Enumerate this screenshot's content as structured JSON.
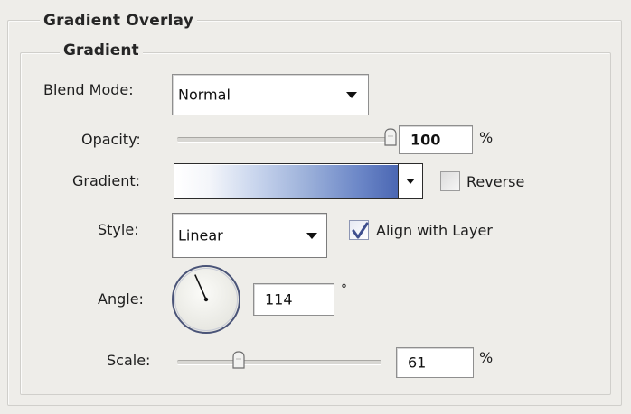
{
  "panel": {
    "section_title": "Gradient Overlay",
    "group_title": "Gradient"
  },
  "blend_mode": {
    "label": "Blend Mode:",
    "value": "Normal"
  },
  "opacity": {
    "label": "Opacity:",
    "value": "100",
    "unit": "%",
    "slider_fraction": 1.0
  },
  "gradient": {
    "label": "Gradient:",
    "colors": [
      "#ffffff",
      "#cbd7ee",
      "#6d88c8",
      "#4b67b3"
    ],
    "reverse_label": "Reverse",
    "reverse_checked": false
  },
  "style": {
    "label": "Style:",
    "value": "Linear",
    "align_label": "Align with Layer",
    "align_checked": true
  },
  "angle": {
    "label": "Angle:",
    "value": "114",
    "unit": "°",
    "degrees": 114
  },
  "scale": {
    "label": "Scale:",
    "value": "61",
    "unit": "%",
    "slider_fraction": 0.3
  },
  "icons": {
    "dropdown": "chevron-down-icon",
    "checkmark": "checkmark-icon",
    "slider_thumb": "slider-thumb-icon"
  }
}
